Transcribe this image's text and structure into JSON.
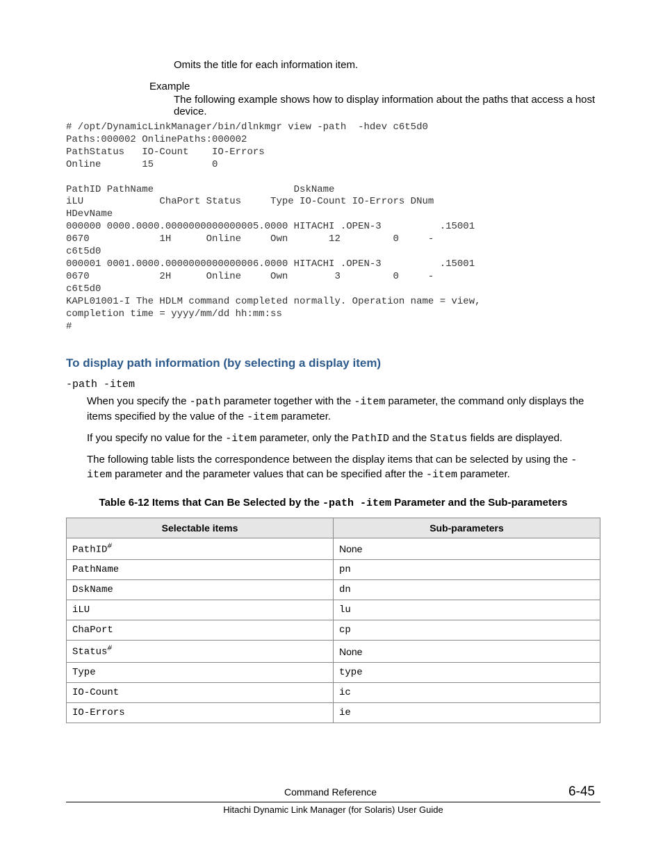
{
  "intro": {
    "omit_line": "Omits the title for each information item.",
    "example_label": "Example",
    "example_body": "The following example shows how to display information about the paths that access a host device."
  },
  "codeblock": "# /opt/DynamicLinkManager/bin/dlnkmgr view -path  -hdev c6t5d0\nPaths:000002 OnlinePaths:000002\nPathStatus   IO-Count    IO-Errors\nOnline       15          0\n\nPathID PathName                        DskName\niLU             ChaPort Status     Type IO-Count IO-Errors DNum\nHDevName\n000000 0000.0000.0000000000000005.0000 HITACHI .OPEN-3          .15001\n0670            1H      Online     Own       12         0     -\nc6t5d0\n000001 0001.0000.0000000000000006.0000 HITACHI .OPEN-3          .15001\n0670            2H      Online     Own        3         0     -\nc6t5d0\nKAPL01001-I The HDLM command completed normally. Operation name = view,\ncompletion time = yyyy/mm/dd hh:mm:ss\n#",
  "section": {
    "heading": "To display path information (by selecting a display item)",
    "param_line": "-path -item",
    "para1_pre": "When you specify the ",
    "para1_code1": "-path",
    "para1_mid": " parameter together with the ",
    "para1_code2": "-item",
    "para1_post": " parameter, the command only displays the items specified by the value of the ",
    "para1_code3": "-item",
    "para1_end": " parameter.",
    "para2_pre": "If you specify no value for the ",
    "para2_code1": "-item",
    "para2_mid": " parameter, only the ",
    "para2_code2": "PathID",
    "para2_mid2": " and the ",
    "para2_code3": "Status",
    "para2_end": " fields are displayed.",
    "para3_pre": "The following table lists the correspondence between the display items that can be selected by using the ",
    "para3_code1": "-item",
    "para3_mid": " parameter and the parameter values that can be specified after the ",
    "para3_code2": "-item",
    "para3_end": " parameter."
  },
  "table": {
    "caption_pre": "Table 6-12 Items that Can Be Selected by the ",
    "caption_code": "-path -item",
    "caption_post": " Parameter and the Sub-parameters",
    "headers": [
      "Selectable items",
      "Sub-parameters"
    ],
    "rows": [
      {
        "item": "PathID",
        "hash": true,
        "sub": "None",
        "sub_code": false
      },
      {
        "item": "PathName",
        "hash": false,
        "sub": "pn",
        "sub_code": true
      },
      {
        "item": "DskName",
        "hash": false,
        "sub": "dn",
        "sub_code": true
      },
      {
        "item": "iLU",
        "hash": false,
        "sub": "lu",
        "sub_code": true
      },
      {
        "item": "ChaPort",
        "hash": false,
        "sub": "cp",
        "sub_code": true
      },
      {
        "item": "Status",
        "hash": true,
        "sub": "None",
        "sub_code": false
      },
      {
        "item": "Type",
        "hash": false,
        "sub": "type",
        "sub_code": true
      },
      {
        "item": "IO-Count",
        "hash": false,
        "sub": "ic",
        "sub_code": true
      },
      {
        "item": "IO-Errors",
        "hash": false,
        "sub": "ie",
        "sub_code": true
      }
    ]
  },
  "footer": {
    "section_title": "Command Reference",
    "page_no": "6-45",
    "book_title": "Hitachi Dynamic Link Manager (for Solaris) User Guide"
  }
}
